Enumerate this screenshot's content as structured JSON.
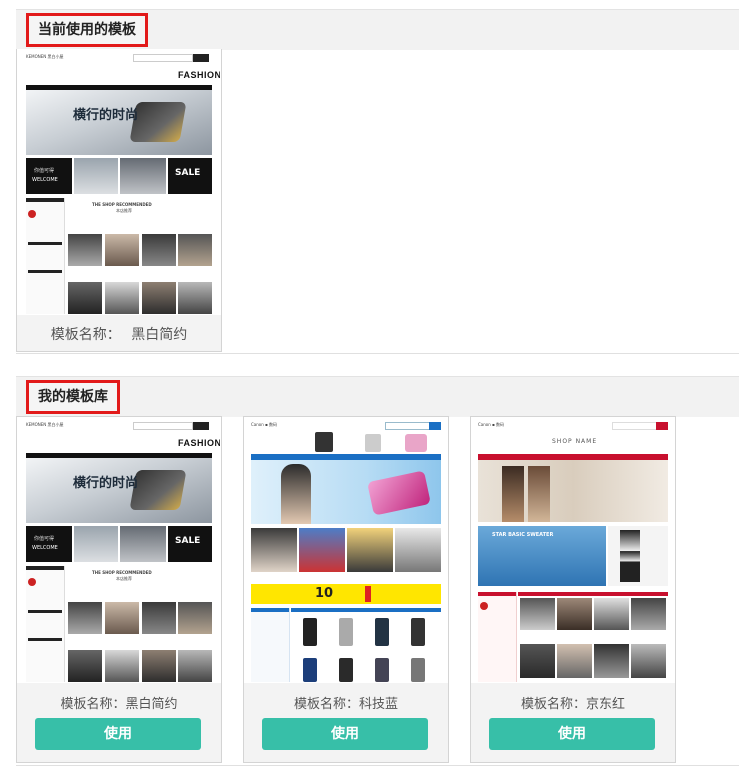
{
  "current": {
    "title": "当前使用的模板",
    "name_label": "模板名称：",
    "name_value": "黑白简约",
    "thumb_text": {
      "shop": "KEMONEN 黑白小屋",
      "logo": "FASHION",
      "banner_title": "横行的时尚",
      "welcome_cn": "你值可得",
      "welcome_en": "WELCOME",
      "sale": "SALE",
      "recommend_en": "THE SHOP RECOMMENDED",
      "recommend_cn": "本店推荐"
    }
  },
  "library": {
    "title": "我的模板库",
    "use_label": "使用",
    "cards": [
      {
        "name": "模板名称：黑白简约",
        "theme": "black"
      },
      {
        "name": "模板名称：科技蓝",
        "theme": "blue",
        "thumb_text": {
          "deal": "10",
          "basic": "STAR BASIC SWEATER"
        }
      },
      {
        "name": "模板名称：京东红",
        "theme": "red",
        "thumb_text": {
          "logo": "SHOP NAME",
          "banner": "STAR BASIC SWEATER"
        }
      }
    ]
  },
  "colors": {
    "accent_red": "#e21a1a",
    "button_teal": "#37bfa8",
    "tech_blue": "#1a6fc4",
    "jd_red": "#c8102e"
  }
}
